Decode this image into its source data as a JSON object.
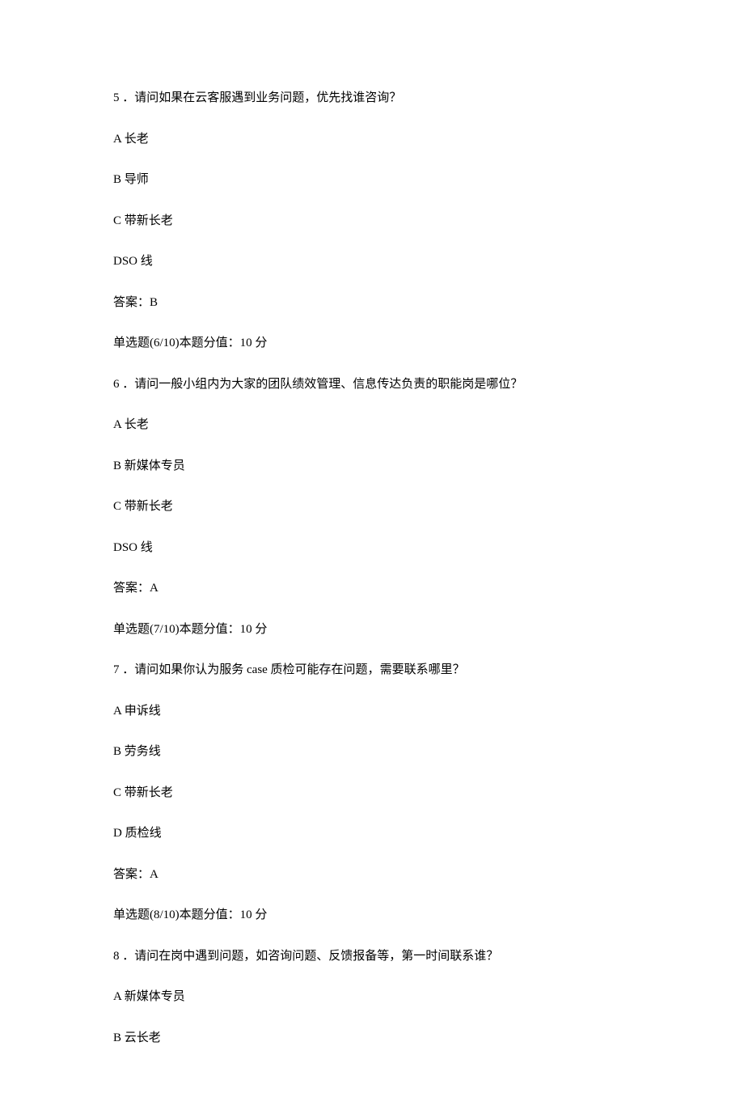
{
  "questions": [
    {
      "number": "5",
      "text": "．请问如果在云客服遇到业务问题，优先找谁咨询？",
      "options": [
        "A 长老",
        "B 导师",
        "C 带新长老",
        "DSO 线"
      ],
      "answer": "答案：B",
      "header": "单选题(6/10)本题分值：10 分"
    },
    {
      "number": "6",
      "text": "．请问一般小组内为大家的团队绩效管理、信息传达负责的职能岗是哪位？",
      "options": [
        "A 长老",
        "B 新媒体专员",
        "C 带新长老",
        "DSO 线"
      ],
      "answer": "答案：A",
      "header": "单选题(7/10)本题分值：10 分"
    },
    {
      "number": "7",
      "text": "．请问如果你认为服务 case 质检可能存在问题，需要联系哪里？",
      "options": [
        "A 申诉线",
        "B 劳务线",
        "C 带新长老",
        "D 质检线"
      ],
      "answer": "答案：A",
      "header": "单选题(8/10)本题分值：10 分"
    },
    {
      "number": "8",
      "text": "．请问在岗中遇到问题，如咨询问题、反馈报备等，第一时间联系谁？",
      "options": [
        "A 新媒体专员",
        "B 云长老"
      ],
      "answer": null,
      "header": null
    }
  ]
}
